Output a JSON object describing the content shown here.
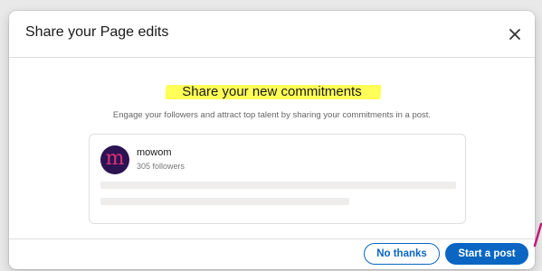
{
  "dialog": {
    "title": "Share your Page edits",
    "close_icon": "close-icon"
  },
  "body": {
    "headline": "Share your new commitments",
    "subtext": "Engage your followers and attract top talent by sharing your commitments in a post."
  },
  "preview": {
    "avatar_letter": "m",
    "org_name": "mowom",
    "followers": "305 followers"
  },
  "footer": {
    "secondary_label": "No thanks",
    "primary_label": "Start a post"
  },
  "colors": {
    "accent": "#0a66c2",
    "highlight": "#ffff3a",
    "avatar_bg": "#2c1452",
    "avatar_letter": "#e0307a",
    "annotation": "#c2187b"
  }
}
